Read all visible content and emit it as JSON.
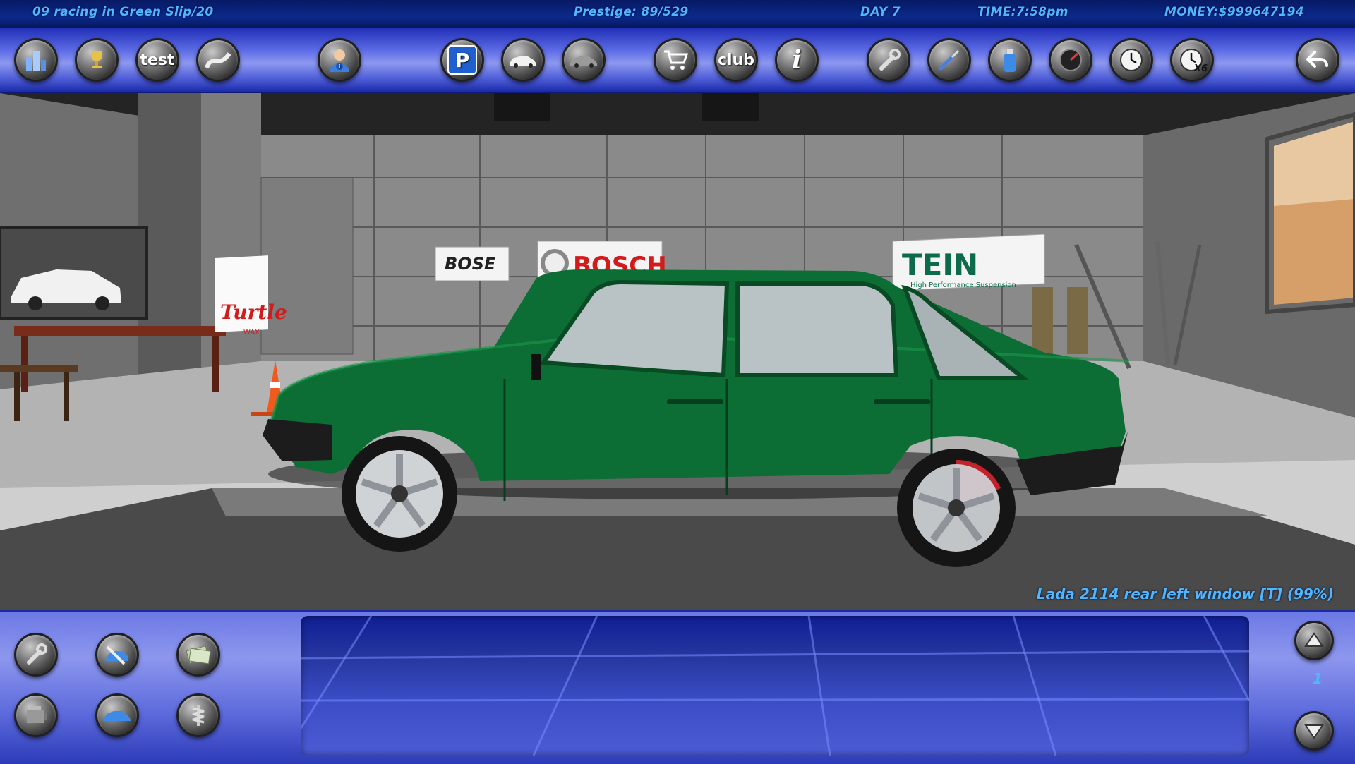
{
  "status": {
    "race": "09 racing in Green Slip/20",
    "prestige": "Prestige: 89/529",
    "day": "DAY 7",
    "time": "TIME:7:58pm",
    "money": "MONEY:$999647194"
  },
  "toolbar": {
    "test_label": "test",
    "club_label": "club",
    "parking_label": "P",
    "info_label": "i",
    "speed_label": "X6"
  },
  "scene": {
    "banners": {
      "bose": "BOSE",
      "bosch": "BOSCH",
      "tein": "TEIN",
      "tein_sub": "High Performance Suspension",
      "turtle": "Turtle",
      "turtle_sub": "WAX"
    },
    "car_color": "#0c6e35"
  },
  "part_label": "Lada 2114 rear left window [T] (99%)",
  "page_indicator": "1",
  "colors": {
    "hud_text": "#4fb6ff",
    "toolbar_blue": "#4d5cd6",
    "status_bar": "#0b2a8a"
  }
}
